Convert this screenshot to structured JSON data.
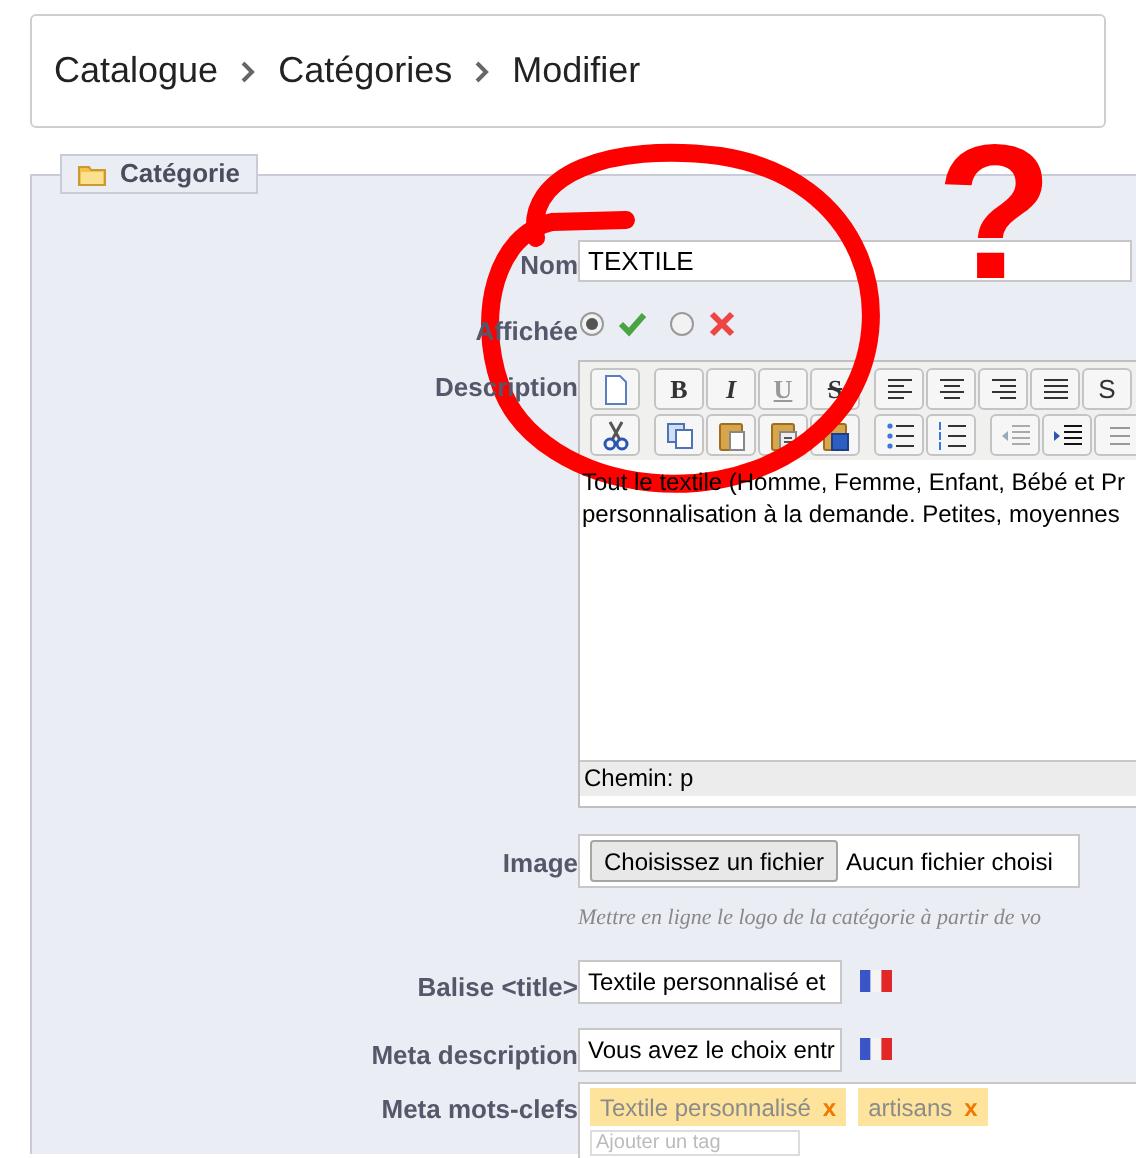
{
  "breadcrumb": [
    "Catalogue",
    "Catégories",
    "Modifier"
  ],
  "panel": {
    "legend": "Catégorie"
  },
  "name_field": {
    "label": "Nom",
    "value": "TEXTILE"
  },
  "displayed": {
    "label": "Affichée",
    "options": [
      {
        "kind": "yes",
        "selected": true
      },
      {
        "kind": "no",
        "selected": false
      }
    ]
  },
  "description": {
    "label": "Description",
    "toolbar_rows": [
      [
        {
          "kind": "new"
        },
        {
          "kind": "bold",
          "text": "B"
        },
        {
          "kind": "italic",
          "text": "I"
        },
        {
          "kind": "underline",
          "text": "U"
        },
        {
          "kind": "strike",
          "text": "S"
        },
        {
          "kind": "align-left"
        },
        {
          "kind": "align-center"
        },
        {
          "kind": "align-right"
        },
        {
          "kind": "justify"
        },
        {
          "kind": "styles",
          "text": "S"
        }
      ],
      [
        {
          "kind": "cut"
        },
        {
          "kind": "copy"
        },
        {
          "kind": "paste"
        },
        {
          "kind": "paste-text"
        },
        {
          "kind": "paste-word"
        },
        {
          "kind": "bullets"
        },
        {
          "kind": "numbers"
        },
        {
          "kind": "outdent"
        },
        {
          "kind": "indent"
        },
        {
          "kind": "more"
        }
      ]
    ],
    "lines": [
      "Tout le textile (Homme, Femme, Enfant, Bébé et Pr",
      "personnalisation à la demande. Petites, moyennes"
    ],
    "path": "Chemin: p"
  },
  "image": {
    "label": "Image",
    "button": "Choisissez un fichier",
    "status": "Aucun fichier choisi",
    "hint": "Mettre en ligne le logo de la catégorie à partir de vo"
  },
  "title_tag": {
    "label": "Balise <title>",
    "value": "Textile personnalisé et"
  },
  "meta_description": {
    "label": "Meta description",
    "value": "Vous avez le choix entr"
  },
  "meta_keywords": {
    "label": "Meta mots-clefs",
    "tags": [
      {
        "text": "Textile personnalisé",
        "remove": "x"
      },
      {
        "text": "artisans",
        "remove": "x"
      }
    ],
    "placeholder": "Ajouter un tag"
  },
  "annotation": {
    "mark": "?"
  }
}
